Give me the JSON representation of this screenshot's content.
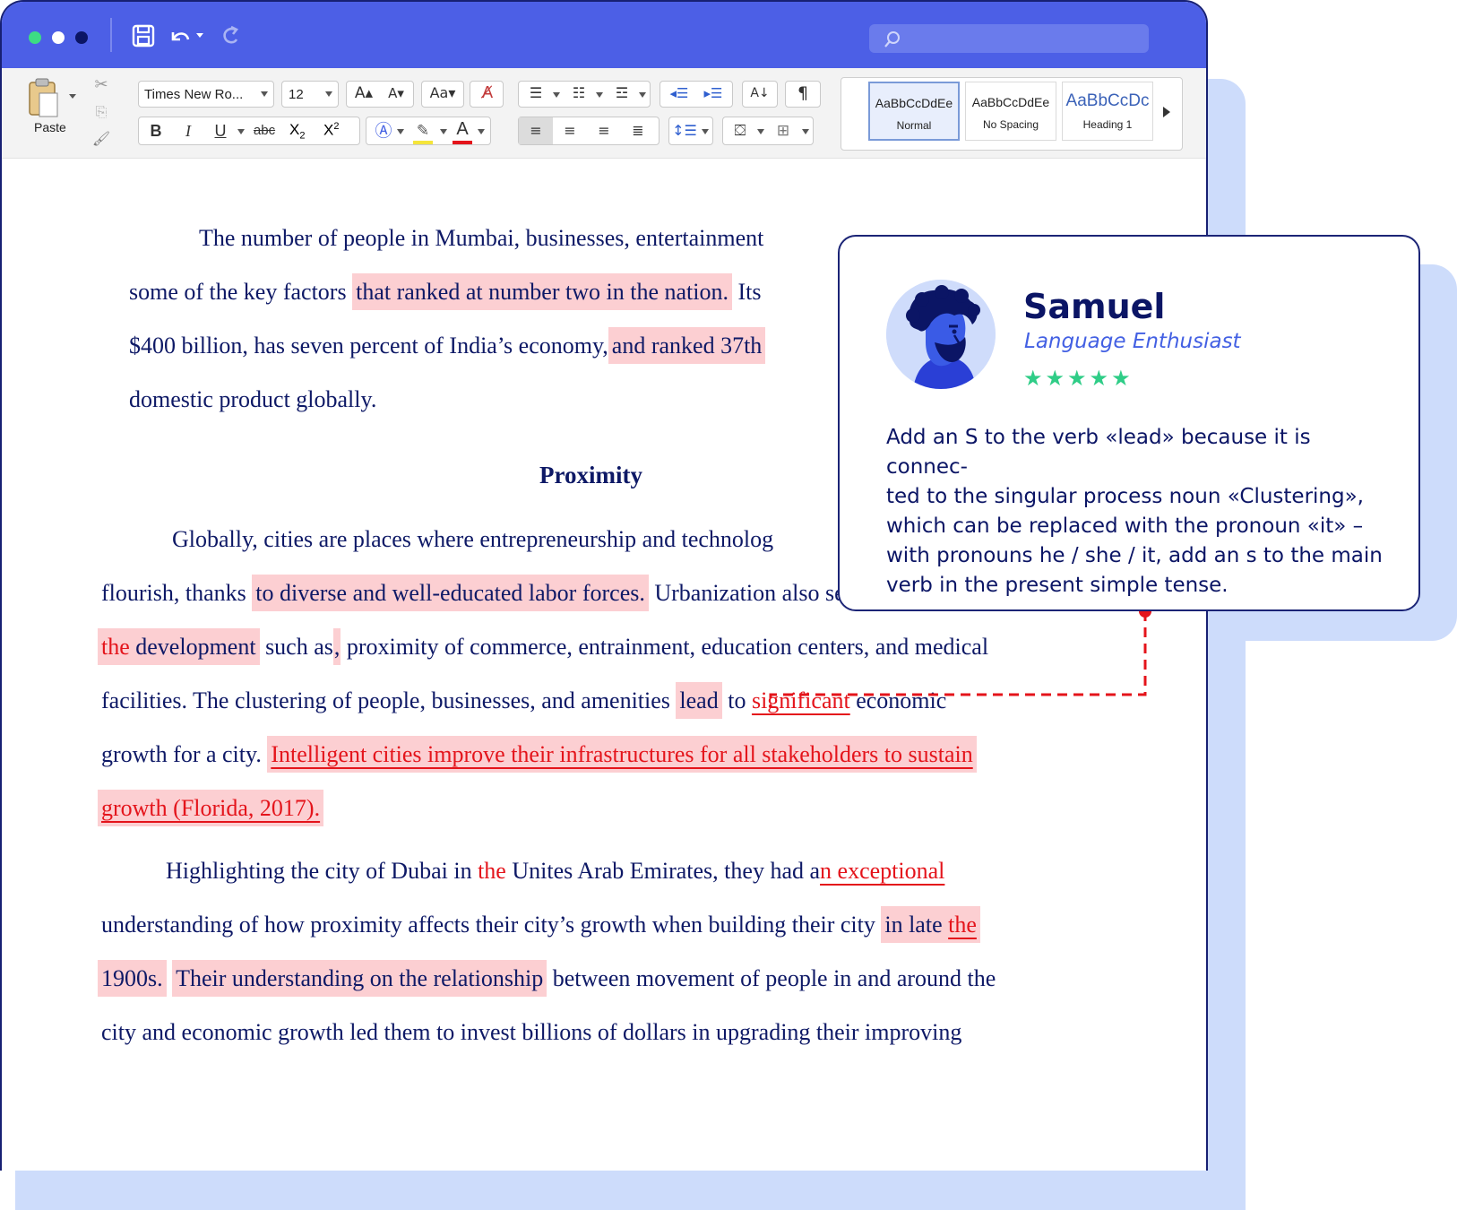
{
  "toolbar": {
    "paste_label": "Paste",
    "font_name": "Times New Ro...",
    "font_size": "12",
    "bold": "B",
    "italic": "I",
    "underline": "U",
    "strikethrough": "abc",
    "subscript": "X",
    "subscript_mark": "2",
    "superscript": "X",
    "superscript_mark": "2",
    "pilcrow": "¶",
    "styles": [
      {
        "sample": "AaBbCcDdEe",
        "name": "Normal"
      },
      {
        "sample": "AaBbCcDdEe",
        "name": "No Spacing"
      },
      {
        "sample": "AaBbCcDc",
        "name": "Heading 1"
      }
    ]
  },
  "document": {
    "p1": {
      "l1": "The number of people in Mumbai, businesses, entertainment",
      "l2a": "some of the key factors ",
      "l2b": "that ranked at number two in the nation.",
      "l2c": " Its",
      "l3a": "$400 billion, has seven percent of India’s economy,",
      "l3b": "and ranked 37th",
      "l4": "domestic product globally."
    },
    "heading": "Proximity",
    "p2": {
      "l1": "Globally, cities are places where entrepreneurship and technolog",
      "l2a": "flourish, thanks ",
      "l2b": "to diverse and well-educated labor forces.",
      "l2c": "  Urbanization also serves as hubs for",
      "l3a": "the",
      "l3b": " development",
      "l3c": " such as",
      "l3d": ",",
      "l3e": " proximity of commerce, entrainment, education centers, and medical",
      "l4a": "facilities.  The clustering of people, businesses, and amenities ",
      "l4b": "lead",
      "l4c": " to ",
      "l4d": "significant",
      "l4e": " economic",
      "l5a": "growth for a city.  ",
      "l5b": "Intelligent cities improve their infrastructures for all stakeholders to sustain",
      "l6": "growth (Florida, 2017)."
    },
    "p3": {
      "l1a": "Highlighting the city of Dubai in ",
      "l1b": "the",
      "l1c": " Unites Arab Emirates, they had a",
      "l1d": "n exceptional",
      "l2a": "understanding of how proximity affects their city’s growth when building their city ",
      "l2b": "in late ",
      "l2c": "the",
      "l3a": "1900s.",
      "l3b": "  ",
      "l3c": "Their understanding on the relationship",
      "l3d": " between movement of people in and around the",
      "l4": "city and economic growth led them to invest billions of dollars in upgrading their improving"
    }
  },
  "feedback": {
    "reviewer_name": "Samuel",
    "reviewer_role": "Language Enthusiast",
    "rating": 5,
    "stars": "★★★★★",
    "comment": "Add an S to the verb «lead» because it is connec-\nted to the singular process noun «Clustering»,\nwhich can be replaced with the pronoun «it» –\nwith pronouns he / she / it, add an s to the main\nverb in the present simple tense."
  },
  "colors": {
    "titlebar": "#4c5fe6",
    "text_navy": "#0e1966",
    "highlight": "#fccfd2",
    "error_red": "#e4141b",
    "star_green": "#2fcd87",
    "accent_blue": "#4360e3"
  }
}
